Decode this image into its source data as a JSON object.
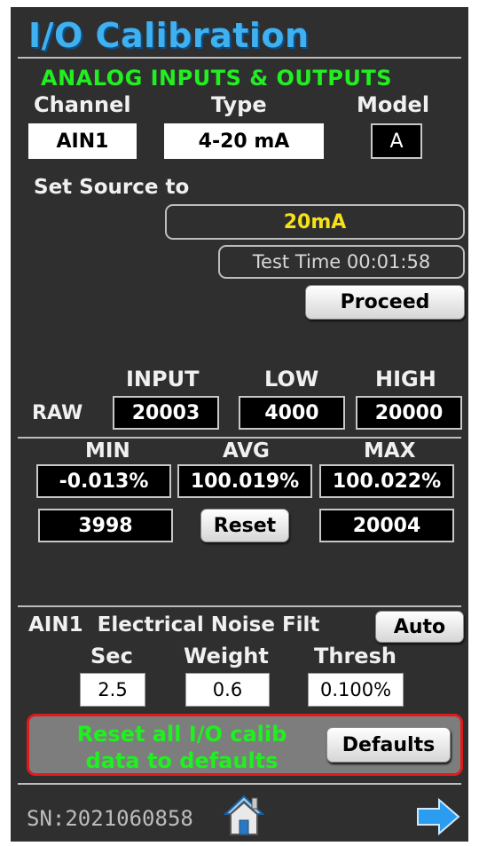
{
  "title": "I/O Calibration",
  "section_title": "ANALOG INPUTS & OUTPUTS",
  "channel": {
    "label": "Channel",
    "value": "AIN1"
  },
  "type": {
    "label": "Type",
    "value": "4-20 mA"
  },
  "model": {
    "label": "Model",
    "value": "A"
  },
  "set_source": {
    "label": "Set Source to",
    "value": "20mA",
    "test_time": "Test Time 00:01:58",
    "proceed_label": "Proceed"
  },
  "raw": {
    "row_label": "RAW",
    "headers": [
      "INPUT",
      "LOW",
      "HIGH"
    ],
    "values": [
      "20003",
      "4000",
      "20000"
    ]
  },
  "stats": {
    "headers": [
      "MIN",
      "AVG",
      "MAX"
    ],
    "percents": [
      "-0.013%",
      "100.019%",
      "100.022%"
    ],
    "min_raw": "3998",
    "max_raw": "20004",
    "reset_label": "Reset"
  },
  "noise_filter": {
    "label": "AIN1  Electrical Noise Filt",
    "auto_label": "Auto",
    "headers": [
      "Sec",
      "Weight",
      "Thresh"
    ],
    "values": [
      "2.5",
      "0.6",
      "0.100%"
    ]
  },
  "defaults": {
    "text_line1": "Reset all I/O calib",
    "text_line2": "data to defaults",
    "button_label": "Defaults"
  },
  "footer": {
    "serial": "SN:2021060858"
  },
  "colors": {
    "title": "#3fb0f0",
    "section": "#22ee22",
    "source_value": "#f5e11a",
    "panel_border": "#e01a1a",
    "next_arrow": "#2a9df0"
  },
  "icons": {
    "home": "home-icon",
    "next": "arrow-right-icon"
  }
}
